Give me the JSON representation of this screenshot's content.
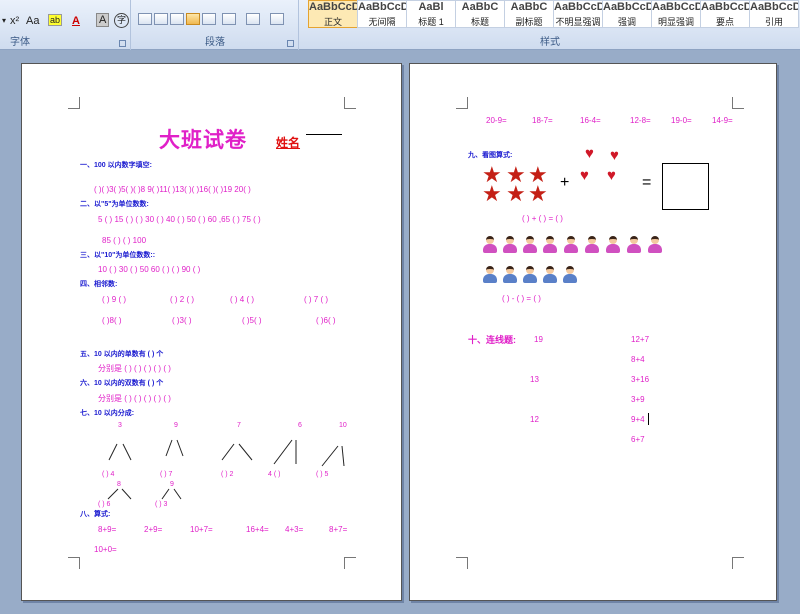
{
  "ribbon": {
    "font_group_label": "字体",
    "paragraph_group_label": "段落",
    "styles_group_label": "样式",
    "font_buttons": {
      "superscript": "x²",
      "font_case": "Aa",
      "font_color": "A",
      "char_shading": "A",
      "char_border": "字"
    },
    "styles": [
      {
        "preview": "AaBbCcDt",
        "label": "正文",
        "selected": true
      },
      {
        "preview": "AaBbCcDt",
        "label": "无间隔"
      },
      {
        "preview": "AaBl",
        "label": "标题 1"
      },
      {
        "preview": "AaBbC",
        "label": "标题"
      },
      {
        "preview": "AaBbC",
        "label": "副标题"
      },
      {
        "preview": "AaBbCcDt",
        "label": "不明显强调"
      },
      {
        "preview": "AaBbCcDt",
        "label": "强调"
      },
      {
        "preview": "AaBbCcDt",
        "label": "明显强调"
      },
      {
        "preview": "AaBbCcDt",
        "label": "要点"
      },
      {
        "preview": "AaBbCcDt",
        "label": "引用"
      }
    ]
  },
  "page1": {
    "title": "大班试卷",
    "name_label": "姓名",
    "s1": {
      "heading": "一、100 以内数字填空:",
      "line": "( )( )3( )5( )( )8 9( )11( )13( )( )16( )( )19 20( )"
    },
    "s2": {
      "heading": "二、以\"5\"为单位数数:",
      "line1": "5 ( ) 15 ( ) ( ) 30 ( ) 40 ( ) 50 ( ) 60 ,65 ( ) 75 ( )",
      "line2": "85 ( ) ( ) 100"
    },
    "s3": {
      "heading": "三、以\"10\"为单位数数::",
      "line": "10 ( ) 30 ( ) 50 60 ( ) ( ) 90 ( )"
    },
    "s4": {
      "heading": "四、相邻数:",
      "row1": [
        "( ) 9 ( )",
        "( ) 2 ( )",
        "( ) 4 ( )",
        "( ) 7 ( )"
      ],
      "row2": [
        "( )8( )",
        "( )3( )",
        "( )5( )",
        "( )6( )"
      ]
    },
    "s5": {
      "heading": "五、10 以内的单数有 (    ) 个",
      "line": "分别是 (    ) (    ) (    ) (    ) (    )"
    },
    "s6": {
      "heading": "六、10 以内的双数有 (    ) 个",
      "line": "分别是 (    ) (    ) (    ) (    ) (    )"
    },
    "s7": {
      "heading": "七、10 以内分成:",
      "tops": [
        "3",
        "9",
        "7",
        "6",
        "10"
      ],
      "bottoms": [
        "( )   4",
        "( )   7",
        "( )   2",
        "4   ( )",
        "( )   5"
      ],
      "tops2": [
        "8",
        "9"
      ],
      "bottoms2": [
        "( )   6",
        "( )   3"
      ]
    },
    "s8": {
      "heading": "八、算式:",
      "items": [
        "8+9=",
        "2+9=",
        "10+7=",
        "16+4=",
        "4+3=",
        "8+7="
      ],
      "item2": "10+0="
    }
  },
  "page2": {
    "top_row": [
      "20-9=",
      "18-7=",
      "16-4=",
      "12-8=",
      "19-0=",
      "14-9="
    ],
    "s9": {
      "heading": "九、看图算式:",
      "plus": "+",
      "equals": "=",
      "eq1": "(     ) + (     ) = (     )",
      "eq2": "(     ) - (     ) = (     )"
    },
    "s10": {
      "heading": "十、连线题:",
      "left": [
        "19",
        "13",
        "12"
      ],
      "right": [
        "12+7",
        "8+4",
        "3+16",
        "3+9",
        "9+4",
        "6+7"
      ]
    }
  },
  "colors": {
    "accent": "#e020c8",
    "heading": "#1a1ad0",
    "name": "#e01010"
  }
}
